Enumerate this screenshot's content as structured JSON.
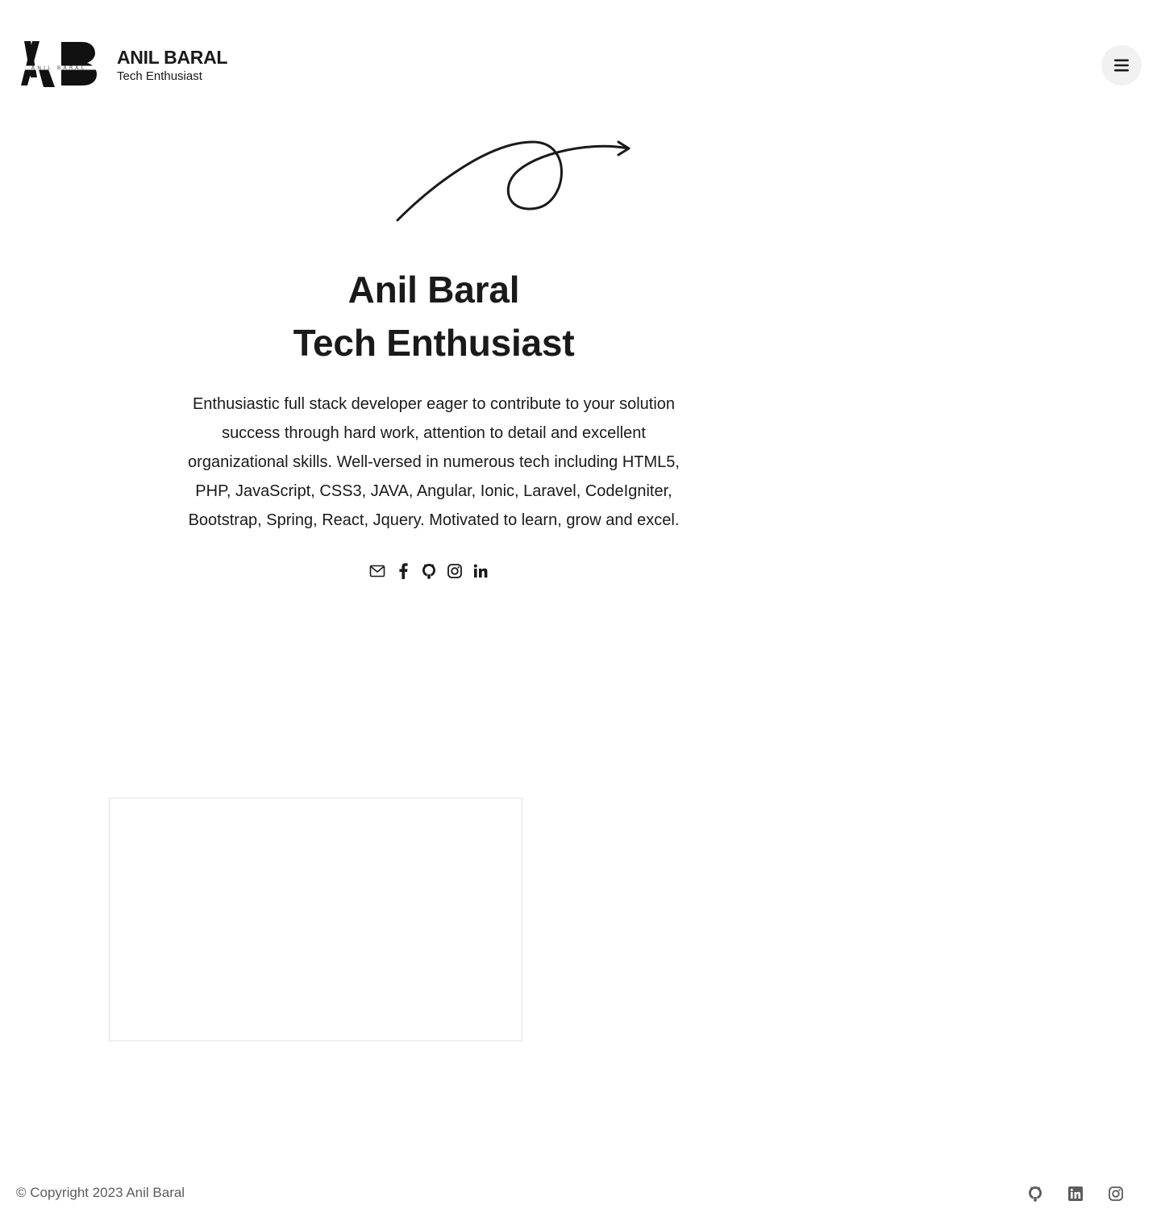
{
  "header": {
    "logo_mark": "AB",
    "logo_subtext": "ANIL BARAL",
    "brand_name": "ANIL BARAL",
    "brand_tagline": "Tech Enthusiast",
    "menu_icon": "hamburger-icon"
  },
  "hero": {
    "title_line1": "Anil Baral",
    "title_line2": "Tech Enthusiast",
    "description": "Enthusiastic full stack developer eager to contribute to your solution success through hard work, attention to detail and excellent organizational skills. Well-versed in numerous tech including HTML5, PHP, JavaScript, CSS3, JAVA, Angular, Ionic, Laravel, CodeIgniter, Bootstrap, Spring, React, Jquery. Motivated to learn, grow and excel.",
    "social_icons": [
      "mail-icon",
      "facebook-icon",
      "github-icon",
      "instagram-icon",
      "linkedin-icon"
    ]
  },
  "footer": {
    "copyright": "© Copyright 2023 Anil Baral",
    "icons": [
      "github-icon",
      "linkedin-icon",
      "instagram-icon"
    ]
  },
  "colors": {
    "text": "#1a1a1a",
    "muted": "#5c5c5c",
    "menu_bg": "#f1f1f1",
    "card_border": "#e2e2e2"
  }
}
